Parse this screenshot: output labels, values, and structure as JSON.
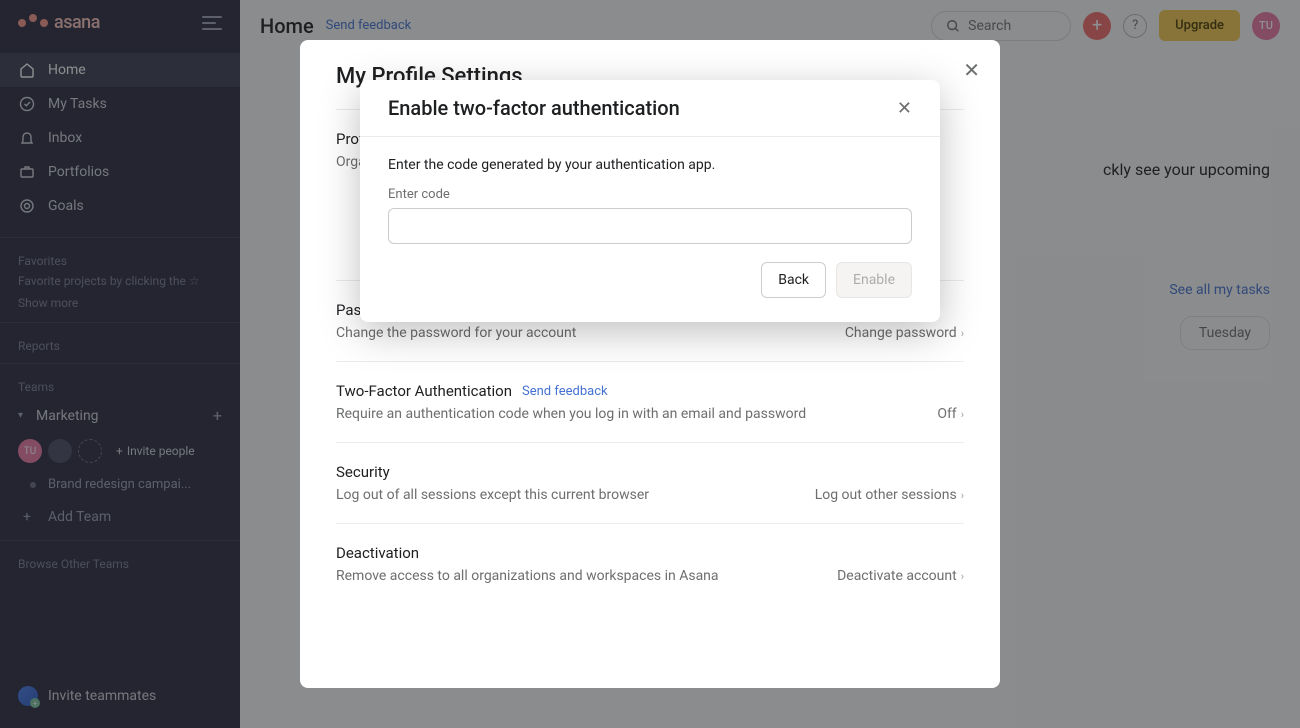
{
  "brand": {
    "name": "asana"
  },
  "sidebar": {
    "nav": [
      {
        "label": "Home"
      },
      {
        "label": "My Tasks"
      },
      {
        "label": "Inbox"
      },
      {
        "label": "Portfolios"
      },
      {
        "label": "Goals"
      }
    ],
    "favorites_heading": "Favorites",
    "favorites_hint": "Favorite projects by clicking the ☆",
    "show_more": "Show more",
    "reports_heading": "Reports",
    "teams_heading": "Teams",
    "team": {
      "name": "Marketing"
    },
    "avatar_initials": "TU",
    "invite_people": "Invite people",
    "project": "Brand redesign campai...",
    "add_team": "Add Team",
    "browse_other": "Browse Other Teams",
    "invite_teammates": "Invite teammates"
  },
  "topbar": {
    "title": "Home",
    "send_feedback": "Send feedback",
    "search_placeholder": "Search",
    "upgrade": "Upgrade",
    "avatar_initials": "TU"
  },
  "background_content": {
    "hint_line": "ckly see your upcoming",
    "see_all": "See all my tasks",
    "pill": "Tuesday"
  },
  "profile_modal": {
    "title": "My Profile Settings",
    "profile_prefix": "Prof",
    "org_prefix": "Orga",
    "password": {
      "title_prefix": "Pass",
      "desc": "Change the password for your account",
      "action": "Change password"
    },
    "two_factor": {
      "title": "Two-Factor Authentication",
      "send_feedback": "Send feedback",
      "desc": "Require an authentication code when you log in with an email and password",
      "status": "Off"
    },
    "security": {
      "title": "Security",
      "desc": "Log out of all sessions except this current browser",
      "action": "Log out other sessions"
    },
    "deactivation": {
      "title": "Deactivation",
      "desc": "Remove access to all organizations and workspaces in Asana",
      "action": "Deactivate account"
    }
  },
  "two_fa_modal": {
    "title": "Enable two-factor authentication",
    "instruction": "Enter the code generated by your authentication app.",
    "label": "Enter code",
    "back": "Back",
    "enable": "Enable"
  }
}
